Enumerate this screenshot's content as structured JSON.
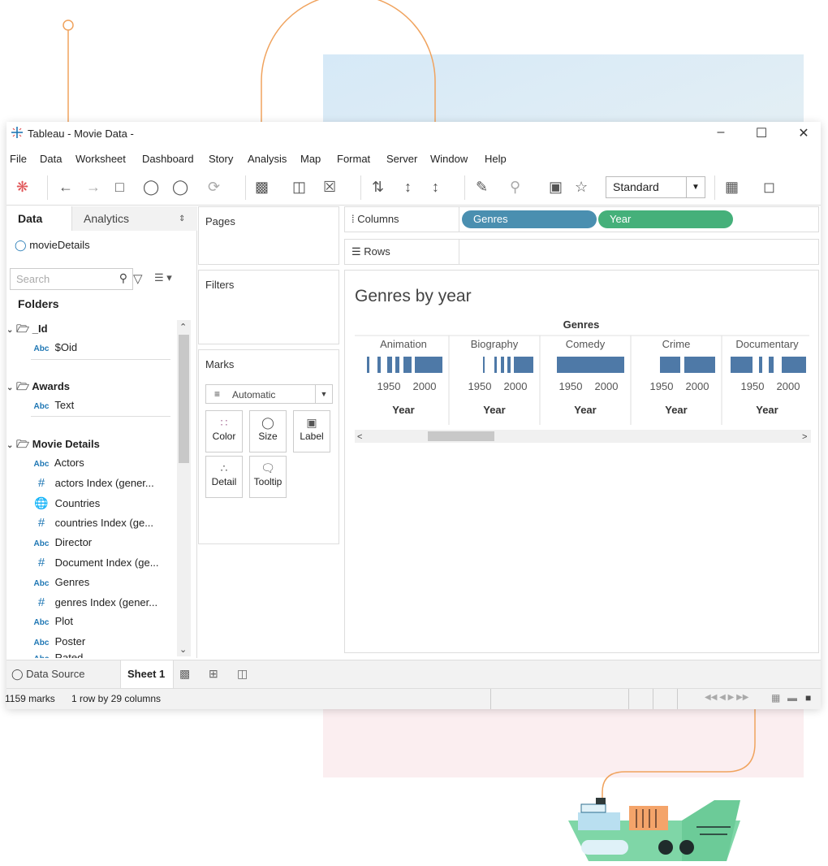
{
  "window": {
    "title": "Tableau - Movie Data -",
    "controls": [
      "minimize-icon",
      "maximize-icon",
      "close-icon"
    ]
  },
  "menu": [
    "File",
    "Data",
    "Worksheet",
    "Dashboard",
    "Story",
    "Analysis",
    "Map",
    "Format",
    "Server",
    "Window",
    "Help"
  ],
  "toolbar": {
    "mark_size": "Standard"
  },
  "left_pane": {
    "tabs": [
      "Data",
      "Analytics"
    ],
    "data_source": "movieDetails",
    "search_placeholder": "Search",
    "folders_label": "Folders",
    "folders": [
      {
        "name": "_Id",
        "items": [
          {
            "type": "Abc",
            "name": "$Oid"
          }
        ]
      },
      {
        "name": "Awards",
        "items": [
          {
            "type": "Abc",
            "name": "Text"
          }
        ]
      },
      {
        "name": "Movie Details",
        "items": [
          {
            "type": "Abc",
            "name": "Actors"
          },
          {
            "type": "#",
            "name": "actors Index (gener..."
          },
          {
            "type": "globe",
            "name": "Countries"
          },
          {
            "type": "#",
            "name": "countries Index (ge..."
          },
          {
            "type": "Abc",
            "name": "Director"
          },
          {
            "type": "#",
            "name": "Document Index (ge..."
          },
          {
            "type": "Abc",
            "name": "Genres"
          },
          {
            "type": "#",
            "name": "genres Index (gener..."
          },
          {
            "type": "Abc",
            "name": "Plot"
          },
          {
            "type": "Abc",
            "name": "Poster"
          },
          {
            "type": "Abc",
            "name": "Rated"
          }
        ]
      }
    ]
  },
  "cards": {
    "pages": "Pages",
    "filters": "Filters",
    "marks": "Marks",
    "mark_type": "Automatic",
    "mark_buttons": [
      "Color",
      "Size",
      "Label",
      "Detail",
      "Tooltip"
    ]
  },
  "shelves": {
    "columns_label": "Columns",
    "rows_label": "Rows",
    "column_pills": [
      {
        "label": "Genres",
        "color": "#4a8fb0"
      },
      {
        "label": "Year",
        "color": "#45b07a"
      }
    ]
  },
  "view": {
    "title": "Genres by year",
    "header": "Genres",
    "axis_label": "Year",
    "ticks": [
      "1950",
      "2000"
    ],
    "columns": [
      "Animation",
      "Biography",
      "Comedy",
      "Crime",
      "Documentary"
    ]
  },
  "chart_data": {
    "type": "bar",
    "title": "Genres by year",
    "categories": [
      "Animation",
      "Biography",
      "Comedy",
      "Crime",
      "Documentary"
    ],
    "xlabel": "Year",
    "x_ticks": [
      "1950",
      "2000"
    ],
    "color": "#4e79a7"
  },
  "bottom": {
    "data_source_tab": "Data Source",
    "sheet_tab": "Sheet 1"
  },
  "status": {
    "marks": "1159 marks",
    "dims": "1 row by 29 columns"
  }
}
